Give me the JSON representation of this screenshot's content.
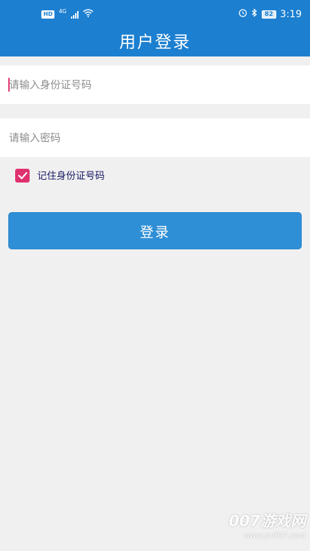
{
  "status_bar": {
    "hd_badge": "HD",
    "network": "4G",
    "battery": "82",
    "time": "3:19"
  },
  "header": {
    "title": "用户登录"
  },
  "form": {
    "id_placeholder": "请输入身份证号码",
    "password_placeholder": "请输入密码",
    "remember_label": "记住身份证号码",
    "remember_checked": true,
    "login_label": "登录"
  },
  "watermark": {
    "brand": "007游戏网",
    "url": "www.yx007.com"
  },
  "colors": {
    "header": "#1c7fd0",
    "button": "#2f8fd6",
    "accent": "#e0316f",
    "background": "#f0f0f0"
  }
}
